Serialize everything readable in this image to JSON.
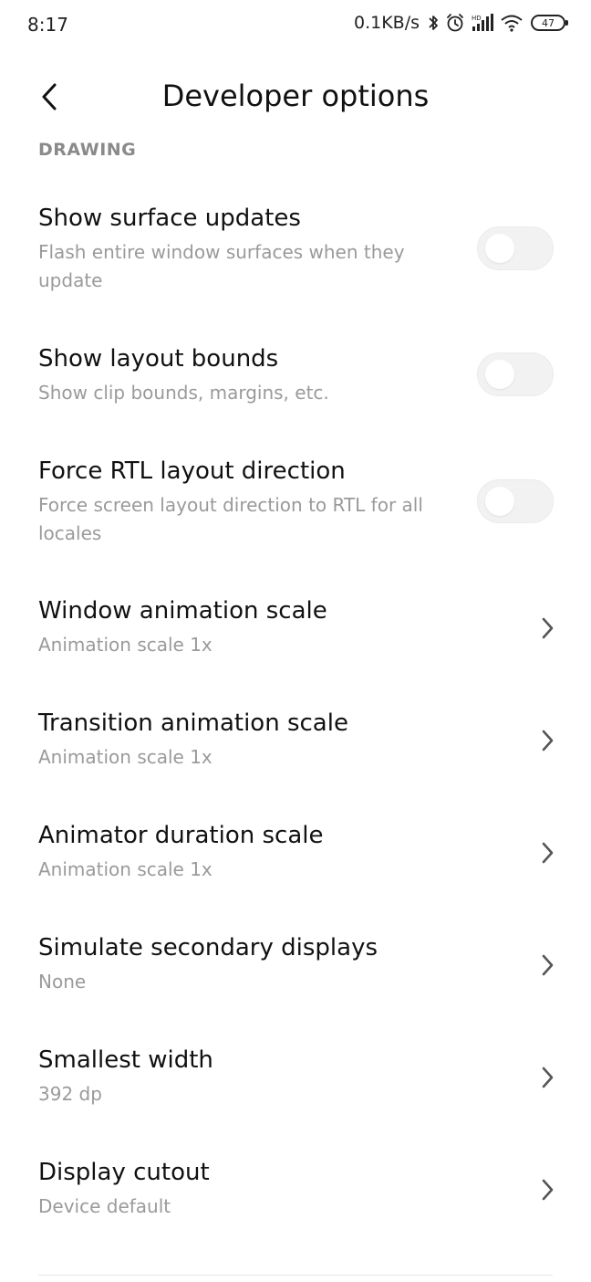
{
  "status_bar": {
    "time": "8:17",
    "net_speed": "0.1KB/s",
    "signal_label": "HD",
    "battery_level": "47",
    "icons": [
      "bluetooth-icon",
      "alarm-icon",
      "signal-icon",
      "wifi-icon",
      "battery-icon"
    ]
  },
  "header": {
    "title": "Developer options",
    "back_icon": "chevron-left-icon"
  },
  "section": {
    "title": "DRAWING"
  },
  "toggle_items": [
    {
      "title": "Show surface updates",
      "subtitle": "Flash entire window surfaces when they update",
      "enabled": false
    },
    {
      "title": "Show layout bounds",
      "subtitle": "Show clip bounds, margins, etc.",
      "enabled": false
    },
    {
      "title": "Force RTL layout direction",
      "subtitle": "Force screen layout direction to RTL for all locales",
      "enabled": false
    }
  ],
  "nav_items": [
    {
      "title": "Window animation scale",
      "subtitle": "Animation scale 1x"
    },
    {
      "title": "Transition animation scale",
      "subtitle": "Animation scale 1x"
    },
    {
      "title": "Animator duration scale",
      "subtitle": "Animation scale 1x"
    },
    {
      "title": "Simulate secondary displays",
      "subtitle": "None"
    },
    {
      "title": "Smallest width",
      "subtitle": "392 dp"
    },
    {
      "title": "Display cutout",
      "subtitle": "Device default"
    }
  ],
  "colors": {
    "title_text": "#111111",
    "subtitle_text": "#9a9a9a",
    "section_text": "#8a8a8a",
    "toggle_off_track": "#f2f2f2",
    "chevron": "#555555"
  }
}
